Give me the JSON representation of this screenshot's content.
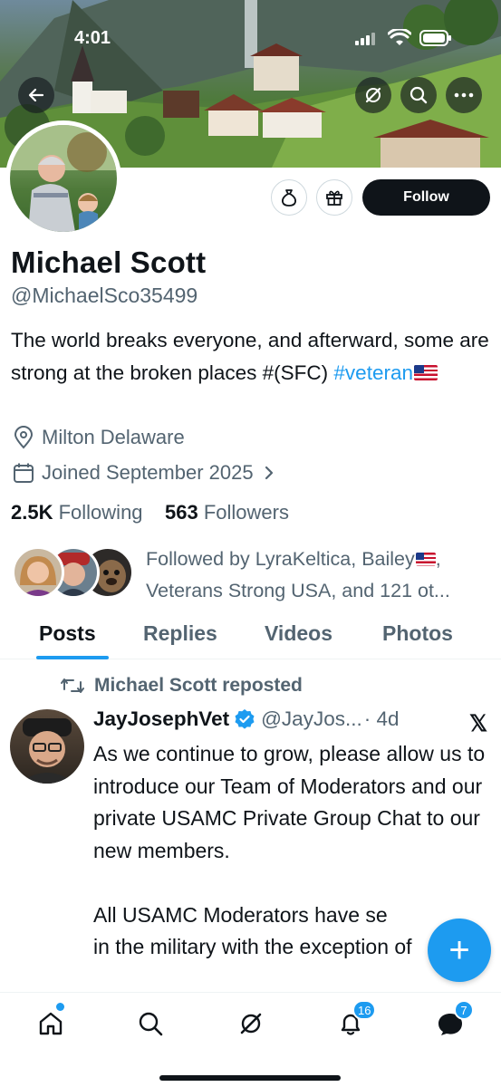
{
  "status_bar": {
    "time": "4:01"
  },
  "profile": {
    "name": "Michael Scott",
    "handle": "@MichaelSco35499",
    "bio_text": "The world breaks everyone, and afterward, some are strong at the broken places #(SFC) ",
    "bio_hashtag": "#veteran",
    "location": "Milton Delaware",
    "joined": "Joined September 2025",
    "following_count": "2.5K",
    "following_label": "Following",
    "followers_count": "563",
    "followers_label": "Followers",
    "follow_button": "Follow",
    "followed_by_line1": "Followed by LyraKeltica, Bailey",
    "followed_by_line2": "Veterans Strong USA, and 121 ot..."
  },
  "tabs": [
    {
      "label": "Posts",
      "active": true
    },
    {
      "label": "Replies",
      "active": false
    },
    {
      "label": "Videos",
      "active": false
    },
    {
      "label": "Photos",
      "active": false
    }
  ],
  "post": {
    "repost_label": "Michael Scott reposted",
    "author_name": "JayJosephVet",
    "author_handle": "@JayJos...",
    "time": "· 4d",
    "x_mark": "𝕏",
    "body": "As we continue to grow, please allow us to introduce our Team of Moderators and our private USAMC Private Group Chat to our new members.\n\nAll USAMC Moderators have se\nin the military with the exception of"
  },
  "fab_label": "+",
  "nav": {
    "notifications_badge": "16",
    "messages_badge": "7"
  },
  "icons": {
    "back": "arrow-left-icon",
    "grok": "grok-icon",
    "search": "search-icon",
    "more": "more-horizontal-icon",
    "tip": "money-bag-icon",
    "gift": "gift-icon",
    "location": "location-pin-icon",
    "calendar": "calendar-icon",
    "verified": "verified-badge-icon",
    "home": "home-icon",
    "notifications": "bell-icon",
    "messages": "message-bubble-icon"
  },
  "colors": {
    "accent": "#1d9bf0",
    "text": "#0f1419",
    "secondary": "#536471"
  }
}
